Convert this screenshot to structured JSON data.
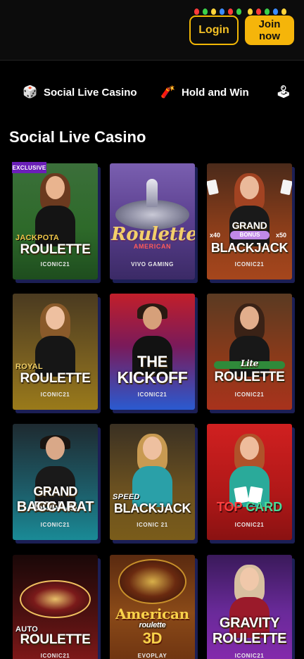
{
  "header": {
    "login_label": "Login",
    "join_label_line1": "Join",
    "join_label_line2": "now",
    "accent_color": "#f5b50a"
  },
  "tabs": [
    {
      "label": "Social Live Casino",
      "icon": "dice-icon",
      "active": true
    },
    {
      "label": "Hold and Win",
      "icon": "dynamite-icon",
      "active": false
    },
    {
      "label": "",
      "icon": "joystick-icon",
      "active": false
    }
  ],
  "section": {
    "title": "Social Live Casino"
  },
  "games": [
    {
      "title_small": "JACKPOTA",
      "title_big": "ROULETTE",
      "provider": "ICONIC21",
      "badge": "EXCLUSIVE"
    },
    {
      "title_small": "",
      "title_big": "Roulette",
      "title_sub": "AMERICAN",
      "provider": "VIVO GAMING"
    },
    {
      "title_small": "GRAND",
      "title_big": "BLACKJACK",
      "title_sub": "BONUS",
      "provider": "ICONIC21",
      "mult_left": "x40",
      "mult_right": "x50"
    },
    {
      "title_small": "ROYAL",
      "title_big": "ROULETTE",
      "provider": "ICONIC21"
    },
    {
      "title_small": "THE",
      "title_big": "KICKOFF",
      "provider": "ICONIC21"
    },
    {
      "title_small": "Lite",
      "title_big": "ROULETTE",
      "provider": "ICONIC21"
    },
    {
      "title_small": "GRAND BONUS",
      "title_big": "BACCARAT",
      "provider": "ICONIC21"
    },
    {
      "title_small": "SPEED",
      "title_big": "BLACKJACK",
      "provider": "ICONIC 21"
    },
    {
      "title_small": "TOP",
      "title_big": "CARD",
      "provider": "ICONIC21"
    },
    {
      "title_small": "AUTO",
      "title_big": "ROULETTE",
      "provider": "ICONIC21"
    },
    {
      "title_small": "American",
      "title_big": "3D",
      "title_sub": "roulette",
      "provider": "EVOPLAY"
    },
    {
      "title_small": "GRAVITY",
      "title_big": "ROULETTE",
      "provider": "ICONIC21"
    }
  ]
}
